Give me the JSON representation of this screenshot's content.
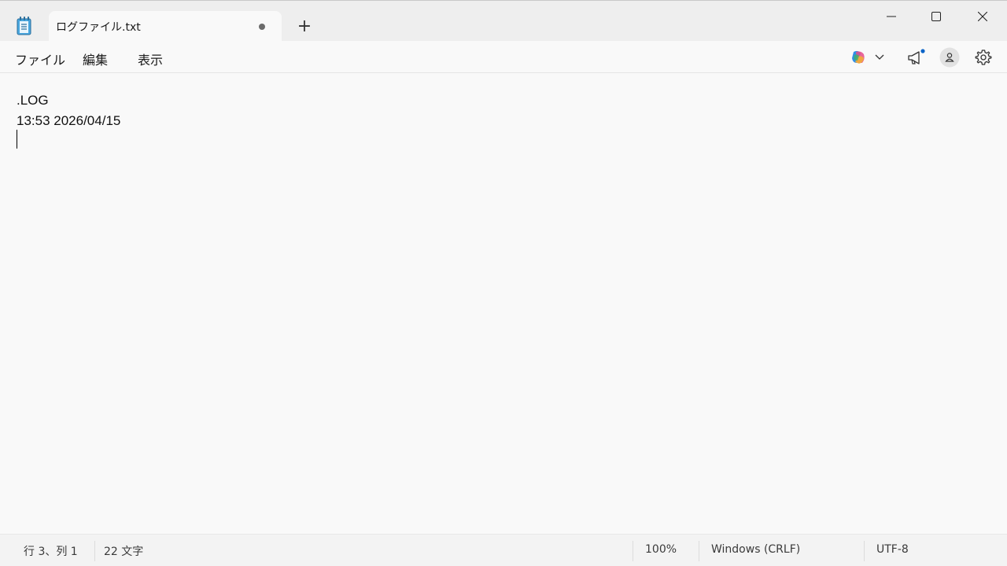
{
  "window": {
    "tab_title": "ログファイル.txt",
    "tab_modified_indicator": "●",
    "new_tab_label": "+",
    "icons": {
      "app": "notepad-icon",
      "minimize": "minimize-icon",
      "maximize": "maximize-icon",
      "close": "close-icon"
    }
  },
  "menu": {
    "items": [
      {
        "label": "ファイル"
      },
      {
        "label": "編集"
      },
      {
        "label": "表示"
      }
    ],
    "tools": {
      "copilot": "copilot-icon",
      "copilot_dropdown": "chevron-down-icon",
      "whats_new": "megaphone-icon",
      "account": "account-icon",
      "settings": "gear-icon"
    }
  },
  "editor": {
    "lines": [
      ".LOG",
      "13:53 2026/04/15",
      ""
    ]
  },
  "status": {
    "position": "行 3、列 1",
    "char_count": "22 文字",
    "zoom": "100%",
    "line_ending": "Windows (CRLF)",
    "encoding": "UTF-8"
  },
  "colors": {
    "accent": "#0a64c8",
    "background": "#f9f9f9"
  }
}
